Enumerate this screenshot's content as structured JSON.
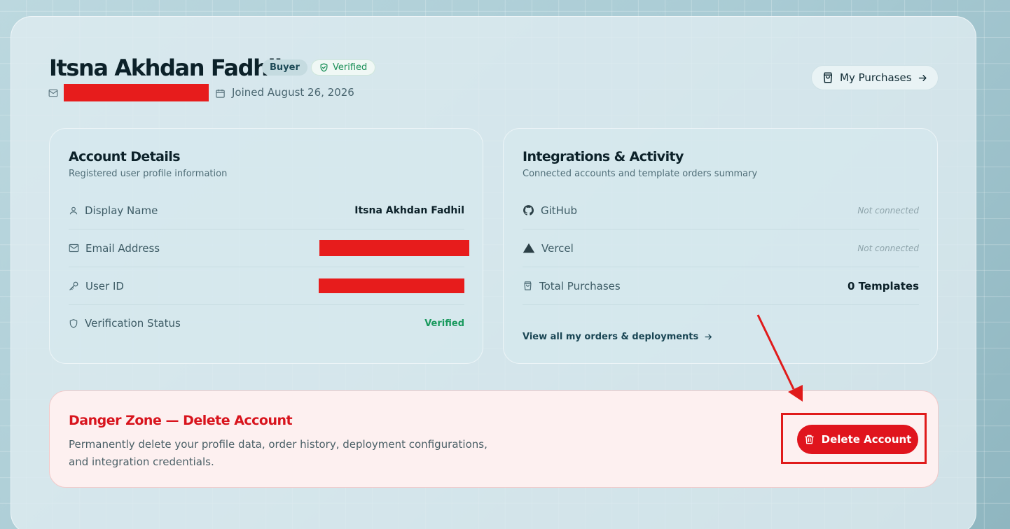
{
  "profile": {
    "name": "Itsna Akhdan Fadhil",
    "role_badge": "Buyer",
    "verified_badge": "Verified",
    "joined": "Joined August 26, 2026"
  },
  "header": {
    "purchases_label": "My Purchases"
  },
  "account_details": {
    "title": "Account Details",
    "subtitle": "Registered user profile information",
    "rows": [
      {
        "label": "Display Name",
        "value": "Itsna Akhdan Fadhil"
      },
      {
        "label": "Email Address",
        "value": ""
      },
      {
        "label": "User ID",
        "value": ""
      },
      {
        "label": "Verification Status",
        "value": "Verified"
      }
    ]
  },
  "integrations": {
    "title": "Integrations & Activity",
    "subtitle": "Connected accounts and template orders summary",
    "rows": [
      {
        "label": "GitHub",
        "value": "Not connected"
      },
      {
        "label": "Vercel",
        "value": "Not connected"
      },
      {
        "label": "Total Purchases",
        "value": "0 Templates"
      }
    ],
    "view_link": "View all my orders & deployments"
  },
  "danger_zone": {
    "title": "Danger Zone — Delete Account",
    "description": "Permanently delete your profile data, order history, deployment configurations, and integration credentials.",
    "button_label": "Delete Account"
  },
  "colors": {
    "danger": "#e0141d",
    "verified": "#1a9a5e",
    "annotation": "#e01b1b"
  }
}
